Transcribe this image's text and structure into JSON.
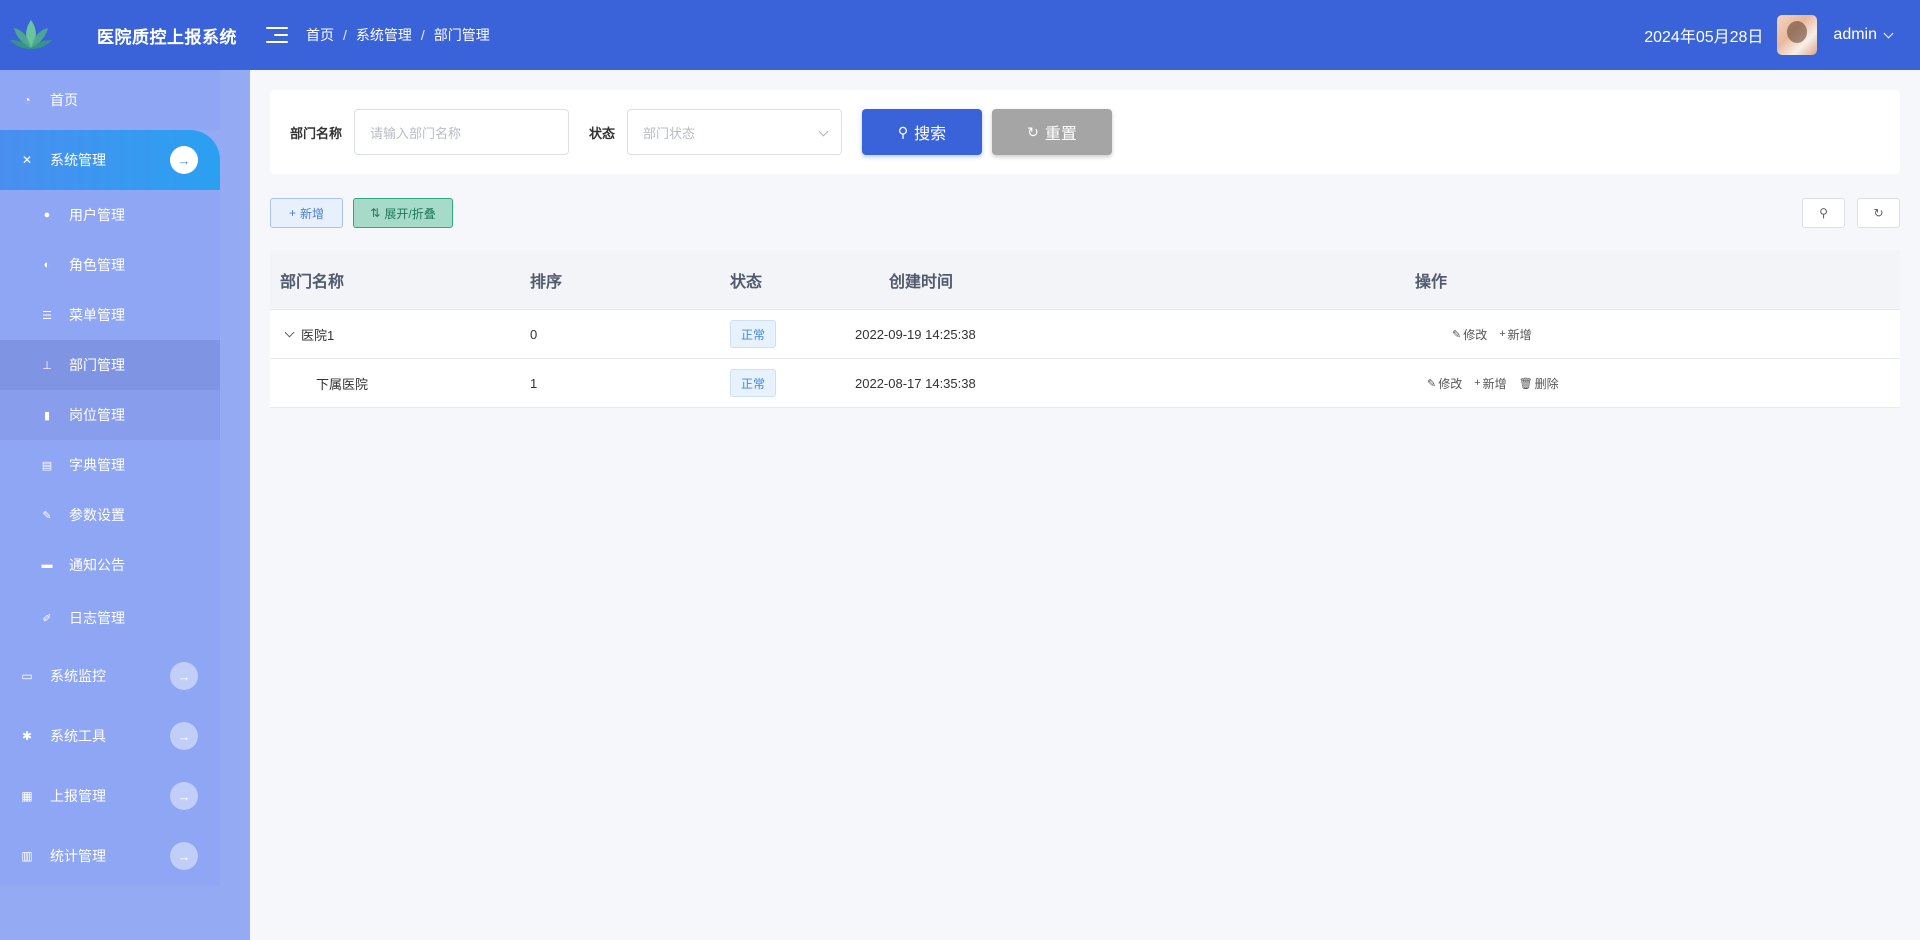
{
  "header": {
    "app_title": "医院质控上报系统",
    "breadcrumb": [
      "首页",
      "系统管理",
      "部门管理"
    ],
    "breadcrumb_sep": "/",
    "date": "2024年05月28日",
    "username": "admin"
  },
  "sidebar": {
    "items": [
      {
        "label": "首页",
        "icon": "dashboard-icon"
      },
      {
        "label": "系统管理",
        "icon": "system-icon",
        "active": true
      },
      {
        "label": "系统监控",
        "icon": "monitor-icon"
      },
      {
        "label": "系统工具",
        "icon": "bug-icon"
      },
      {
        "label": "上报管理",
        "icon": "table-icon"
      },
      {
        "label": "统计管理",
        "icon": "chart-icon"
      }
    ],
    "sub_items": [
      {
        "label": "用户管理",
        "icon": "user-icon"
      },
      {
        "label": "角色管理",
        "icon": "peoples-icon"
      },
      {
        "label": "菜单管理",
        "icon": "tree-table-icon"
      },
      {
        "label": "部门管理",
        "icon": "tree-icon",
        "active": true
      },
      {
        "label": "岗位管理",
        "icon": "post-icon"
      },
      {
        "label": "字典管理",
        "icon": "dict-icon"
      },
      {
        "label": "参数设置",
        "icon": "edit-icon"
      },
      {
        "label": "通知公告",
        "icon": "message-icon"
      },
      {
        "label": "日志管理",
        "icon": "log-icon"
      }
    ]
  },
  "search": {
    "dept_name_label": "部门名称",
    "dept_name_placeholder": "请输入部门名称",
    "status_label": "状态",
    "status_placeholder": "部门状态",
    "search_button": "搜索",
    "reset_button": "重置"
  },
  "toolbar": {
    "add_label": "新增",
    "expand_label": "展开/折叠"
  },
  "table": {
    "columns": [
      "部门名称",
      "排序",
      "状态",
      "创建时间",
      "操作"
    ],
    "rows": [
      {
        "name": "医院1",
        "order": "0",
        "status": "正常",
        "created": "2022-09-19 14:25:38",
        "actions": [
          "修改",
          "新增"
        ],
        "expanded": true
      },
      {
        "name": "下属医院",
        "order": "1",
        "status": "正常",
        "created": "2022-08-17 14:35:38",
        "actions": [
          "修改",
          "新增",
          "删除"
        ]
      }
    ]
  },
  "colors": {
    "header_bg": "#3b63d9",
    "sidebar_bg": "#8ea6f3",
    "active_menu": "#2aa0f0",
    "primary": "#3b63d9",
    "reset": "#a5a5a5"
  }
}
